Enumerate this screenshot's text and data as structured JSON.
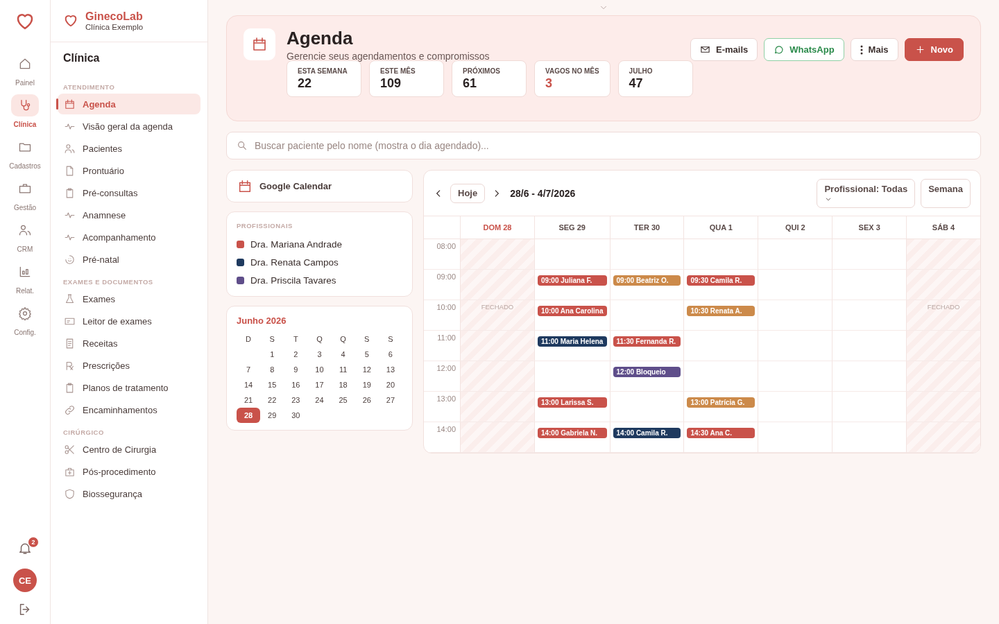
{
  "rail": {
    "items": [
      {
        "label": "Painel",
        "selected": false
      },
      {
        "label": "Clínica",
        "selected": true
      },
      {
        "label": "Cadastros",
        "selected": false
      },
      {
        "label": "Gestão",
        "selected": false
      },
      {
        "label": "CRM",
        "selected": false
      },
      {
        "label": "Relat.",
        "selected": false
      },
      {
        "label": "Config.",
        "selected": false
      }
    ],
    "notifications": "2",
    "avatar": "CE"
  },
  "brand": {
    "name": "GinecoLab",
    "subtitle": "Clínica Exemplo"
  },
  "nav": {
    "title": "Clínica",
    "sections": [
      {
        "title": "ATENDIMENTO",
        "items": [
          {
            "label": "Agenda",
            "selected": true
          },
          {
            "label": "Visão geral da agenda",
            "selected": false
          },
          {
            "label": "Pacientes",
            "selected": false
          },
          {
            "label": "Prontuário",
            "selected": false
          },
          {
            "label": "Pré-consultas",
            "selected": false
          },
          {
            "label": "Anamnese",
            "selected": false
          },
          {
            "label": "Acompanhamento",
            "selected": false
          },
          {
            "label": "Pré-natal",
            "selected": false
          }
        ]
      },
      {
        "title": "EXAMES E DOCUMENTOS",
        "items": [
          {
            "label": "Exames",
            "selected": false
          },
          {
            "label": "Leitor de exames",
            "selected": false
          },
          {
            "label": "Receitas",
            "selected": false
          },
          {
            "label": "Prescrições",
            "selected": false
          },
          {
            "label": "Planos de tratamento",
            "selected": false
          },
          {
            "label": "Encaminhamentos",
            "selected": false
          }
        ]
      },
      {
        "title": "CIRÚRGICO",
        "items": [
          {
            "label": "Centro de Cirurgia",
            "selected": false
          },
          {
            "label": "Pós-procedimento",
            "selected": false
          },
          {
            "label": "Biossegurança",
            "selected": false
          }
        ]
      }
    ]
  },
  "header": {
    "title": "Agenda",
    "subtitle": "Gerencie seus agendamentos e compromissos",
    "buttons": [
      {
        "label": "E-mails",
        "kind": "mail"
      },
      {
        "label": "WhatsApp",
        "kind": "whatsapp"
      },
      {
        "label": "Mais",
        "kind": "more"
      },
      {
        "label": "Novo",
        "kind": "primary"
      }
    ],
    "stats": [
      {
        "label": "ESTA SEMANA",
        "value": "22",
        "alert": false
      },
      {
        "label": "ESTE MÊS",
        "value": "109",
        "alert": false
      },
      {
        "label": "PRÓXIMOS",
        "value": "61",
        "alert": false
      },
      {
        "label": "VAGOS NO MÊS",
        "value": "3",
        "alert": true
      },
      {
        "label": "JULHO",
        "value": "47",
        "alert": false
      }
    ]
  },
  "search": {
    "placeholder": "Buscar paciente pelo nome (mostra o dia agendado)..."
  },
  "google_calendar": {
    "label": "Google Calendar"
  },
  "professionals": {
    "title": "PROFISSIONAIS",
    "items": [
      {
        "name": "Dra. Mariana Andrade",
        "color": "#c9524a"
      },
      {
        "name": "Dra. Renata Campos",
        "color": "#1f3a5f"
      },
      {
        "name": "Dra. Priscila Tavares",
        "color": "#5f4e8a"
      }
    ]
  },
  "mini_calendar": {
    "title": "Junho 2026",
    "weekdays": [
      "D",
      "S",
      "T",
      "Q",
      "Q",
      "S",
      "S"
    ],
    "weeks": [
      {
        "kind": "first",
        "days": [
          {
            "day": "1",
            "selected": false
          },
          {
            "day": "2",
            "selected": false
          },
          {
            "day": "3",
            "selected": false
          },
          {
            "day": "4",
            "selected": false
          },
          {
            "day": "5",
            "selected": false
          },
          {
            "day": "6",
            "selected": false
          }
        ]
      },
      {
        "kind": "full",
        "days": [
          {
            "day": "7",
            "selected": false
          },
          {
            "day": "8",
            "selected": false
          },
          {
            "day": "9",
            "selected": false
          },
          {
            "day": "10",
            "selected": false
          },
          {
            "day": "11",
            "selected": false
          },
          {
            "day": "12",
            "selected": false
          },
          {
            "day": "13",
            "selected": false
          }
        ]
      },
      {
        "kind": "full",
        "days": [
          {
            "day": "14",
            "selected": false
          },
          {
            "day": "15",
            "selected": false
          },
          {
            "day": "16",
            "selected": false
          },
          {
            "day": "17",
            "selected": false
          },
          {
            "day": "18",
            "selected": false
          },
          {
            "day": "19",
            "selected": false
          },
          {
            "day": "20",
            "selected": false
          }
        ]
      },
      {
        "kind": "full",
        "days": [
          {
            "day": "21",
            "selected": false
          },
          {
            "day": "22",
            "selected": false
          },
          {
            "day": "23",
            "selected": false
          },
          {
            "day": "24",
            "selected": false
          },
          {
            "day": "25",
            "selected": false
          },
          {
            "day": "26",
            "selected": false
          },
          {
            "day": "27",
            "selected": false
          }
        ]
      },
      {
        "kind": "last",
        "days": [
          {
            "day": "28",
            "selected": true
          },
          {
            "day": "29",
            "selected": false
          },
          {
            "day": "30",
            "selected": false
          }
        ]
      }
    ]
  },
  "calendar": {
    "today_button": "Hoje",
    "range": "28/6 - 4/7/2026",
    "filter": "Profissional: Todas",
    "view": "Semana",
    "days": [
      {
        "label": "DOM 28",
        "today": true,
        "closed": true
      },
      {
        "label": "SEG 29",
        "today": false,
        "closed": false
      },
      {
        "label": "TER 30",
        "today": false,
        "closed": false
      },
      {
        "label": "QUA 1",
        "today": false,
        "closed": false
      },
      {
        "label": "QUI 2",
        "today": false,
        "closed": false
      },
      {
        "label": "SEX 3",
        "today": false,
        "closed": false
      },
      {
        "label": "SÁB 4",
        "today": false,
        "closed": true
      }
    ],
    "rows": [
      {
        "time": "08:00",
        "cells": [
          {},
          {},
          {},
          {},
          {},
          {},
          {}
        ]
      },
      {
        "time": "09:00",
        "cells": [
          {},
          {
            "events": [
              {
                "label": "09:00 Juliana F.",
                "color": "#c9524a"
              }
            ]
          },
          {
            "events": [
              {
                "label": "09:00 Beatriz O.",
                "color": "#cc8a4a"
              }
            ]
          },
          {
            "events": [
              {
                "label": "09:30 Camila R.",
                "color": "#c9524a"
              }
            ]
          },
          {},
          {},
          {}
        ]
      },
      {
        "time": "10:00",
        "cells": [
          {
            "note": "FECHADO"
          },
          {
            "events": [
              {
                "label": "10:00 Ana Carolina",
                "color": "#c9524a"
              }
            ]
          },
          {},
          {
            "events": [
              {
                "label": "10:30 Renata A.",
                "color": "#cc8a4a"
              }
            ]
          },
          {},
          {},
          {
            "note": "FECHADO"
          }
        ]
      },
      {
        "time": "11:00",
        "cells": [
          {},
          {
            "events": [
              {
                "label": "11:00 Maria Helena",
                "color": "#1f3a5f"
              }
            ]
          },
          {
            "events": [
              {
                "label": "11:30 Fernanda R.",
                "color": "#c9524a"
              }
            ]
          },
          {},
          {},
          {},
          {}
        ]
      },
      {
        "time": "12:00",
        "cells": [
          {},
          {},
          {
            "events": [
              {
                "label": "12:00 Bloqueio",
                "color": "#5f4e8a"
              }
            ]
          },
          {},
          {},
          {},
          {}
        ]
      },
      {
        "time": "13:00",
        "cells": [
          {},
          {
            "events": [
              {
                "label": "13:00 Larissa S.",
                "color": "#c9524a"
              }
            ]
          },
          {},
          {
            "events": [
              {
                "label": "13:00 Patrícia G.",
                "color": "#cc8a4a"
              }
            ]
          },
          {},
          {},
          {}
        ]
      },
      {
        "time": "14:00",
        "cells": [
          {},
          {
            "events": [
              {
                "label": "14:00 Gabriela N.",
                "color": "#c9524a"
              }
            ]
          },
          {
            "events": [
              {
                "label": "14:00 Camila R.",
                "color": "#1f3a5f"
              }
            ]
          },
          {
            "events": [
              {
                "label": "14:30 Ana C.",
                "color": "#c9524a"
              }
            ]
          },
          {},
          {},
          {}
        ]
      }
    ]
  }
}
